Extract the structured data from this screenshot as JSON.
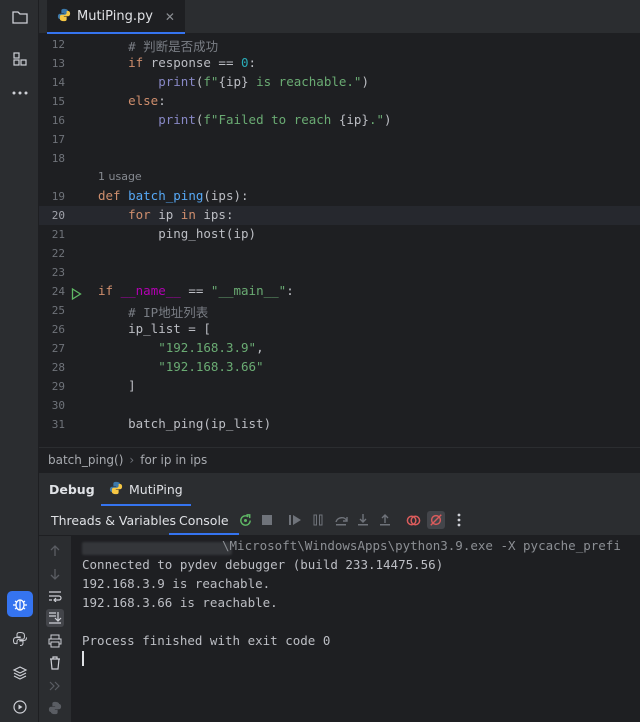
{
  "editor": {
    "tab": {
      "filename": "MutiPing.py"
    },
    "lines": [
      {
        "n": "12",
        "tokens": [
          [
            "    ",
            ""
          ],
          [
            "# 判断是否成功",
            "cmt"
          ]
        ]
      },
      {
        "n": "13",
        "tokens": [
          [
            "    ",
            ""
          ],
          [
            "if",
            "kw"
          ],
          [
            " response == ",
            ""
          ],
          [
            "0",
            "num"
          ],
          [
            ":",
            ""
          ]
        ]
      },
      {
        "n": "14",
        "tokens": [
          [
            "        ",
            ""
          ],
          [
            "print",
            "bi"
          ],
          [
            "(",
            ""
          ],
          [
            "f\"",
            "str"
          ],
          [
            "{ip}",
            ""
          ],
          [
            " is reachable.\"",
            "str"
          ],
          [
            ")",
            ""
          ]
        ]
      },
      {
        "n": "15",
        "tokens": [
          [
            "    ",
            ""
          ],
          [
            "else",
            "kw"
          ],
          [
            ":",
            ""
          ]
        ]
      },
      {
        "n": "16",
        "tokens": [
          [
            "        ",
            ""
          ],
          [
            "print",
            "bi"
          ],
          [
            "(",
            ""
          ],
          [
            "f\"Failed to reach ",
            "str"
          ],
          [
            "{ip}",
            ""
          ],
          [
            ".\"",
            "str"
          ],
          [
            ")",
            ""
          ]
        ]
      },
      {
        "n": "17",
        "tokens": []
      },
      {
        "n": "18",
        "tokens": []
      },
      {
        "n": "19",
        "tokens": [
          [
            "def",
            "kw"
          ],
          [
            " ",
            ""
          ],
          [
            "batch_ping",
            "fn"
          ],
          [
            "(ips):",
            ""
          ]
        ]
      },
      {
        "n": "20",
        "tokens": [
          [
            "    ",
            ""
          ],
          [
            "for",
            "kw"
          ],
          [
            " ip ",
            ""
          ],
          [
            "in",
            "kw"
          ],
          [
            " ips:",
            ""
          ]
        ]
      },
      {
        "n": "21",
        "tokens": [
          [
            "        ping_host(ip)",
            ""
          ]
        ]
      },
      {
        "n": "22",
        "tokens": []
      },
      {
        "n": "23",
        "tokens": []
      },
      {
        "n": "24",
        "tokens": [
          [
            "if",
            "kw"
          ],
          [
            " ",
            ""
          ],
          [
            "__name__",
            "dund"
          ],
          [
            " == ",
            ""
          ],
          [
            "\"__main__\"",
            "str"
          ],
          [
            ":",
            ""
          ]
        ]
      },
      {
        "n": "25",
        "tokens": [
          [
            "    ",
            ""
          ],
          [
            "# IP地址列表",
            "cmt"
          ]
        ]
      },
      {
        "n": "26",
        "tokens": [
          [
            "    ip_list = [",
            ""
          ]
        ]
      },
      {
        "n": "27",
        "tokens": [
          [
            "        ",
            ""
          ],
          [
            "\"192.168.3.9\"",
            "str"
          ],
          [
            ",",
            ""
          ]
        ]
      },
      {
        "n": "28",
        "tokens": [
          [
            "        ",
            ""
          ],
          [
            "\"192.168.3.66\"",
            "str"
          ]
        ]
      },
      {
        "n": "29",
        "tokens": [
          [
            "    ]",
            ""
          ]
        ]
      },
      {
        "n": "30",
        "tokens": []
      },
      {
        "n": "31",
        "tokens": [
          [
            "    batch_ping(ip_list)",
            ""
          ]
        ]
      }
    ],
    "usage_hint": "1 usage",
    "current_line": "20"
  },
  "breadcrumb": [
    "batch_ping()",
    "for ip in ips"
  ],
  "debug": {
    "title": "Debug",
    "session": "MutiPing",
    "tabs": {
      "threads": "Threads & Variables",
      "console": "Console"
    }
  },
  "console": {
    "lines": [
      "\\Microsoft\\WindowsApps\\python3.9.exe -X pycache_prefi",
      "Connected to pydev debugger (build 233.14475.56)",
      "192.168.3.9 is reachable.",
      "192.168.3.66 is reachable.",
      "",
      "Process finished with exit code 0"
    ]
  },
  "colors": {
    "accent": "#3574f0",
    "keyword": "#cf8e6d",
    "function": "#56a8f5",
    "string": "#6aab73",
    "number": "#2aacb8",
    "comment": "#7a7e85"
  },
  "icons": [
    "folder-icon",
    "structure-icon",
    "more-icon",
    "debug-icon",
    "python-console-icon",
    "layers-icon",
    "services-icon",
    "python-file-icon",
    "run-gutter-icon"
  ]
}
